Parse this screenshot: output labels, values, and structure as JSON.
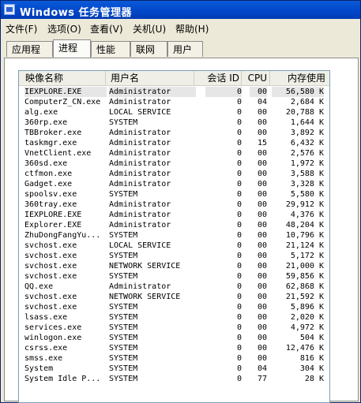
{
  "window": {
    "title": "Windows 任务管理器"
  },
  "menu": [
    "文件(F)",
    "选项(O)",
    "查看(V)",
    "关机(U)",
    "帮助(H)"
  ],
  "tabs": [
    "应用程序",
    "进程",
    "性能",
    "联网",
    "用户"
  ],
  "active_tab": "进程",
  "columns": [
    "映像名称",
    "用户名",
    "会话 ID",
    "CPU",
    "内存使用"
  ],
  "processes": [
    {
      "name": "IEXPLORE.EXE",
      "user": "Administrator",
      "session": "0",
      "cpu": "00",
      "mem": "56,580 K"
    },
    {
      "name": "ComputerZ_CN.exe",
      "user": "Administrator",
      "session": "0",
      "cpu": "04",
      "mem": "2,684 K"
    },
    {
      "name": "alg.exe",
      "user": "LOCAL SERVICE",
      "session": "0",
      "cpu": "00",
      "mem": "20,788 K"
    },
    {
      "name": "360rp.exe",
      "user": "SYSTEM",
      "session": "0",
      "cpu": "00",
      "mem": "1,644 K"
    },
    {
      "name": "TBBroker.exe",
      "user": "Administrator",
      "session": "0",
      "cpu": "00",
      "mem": "3,892 K"
    },
    {
      "name": "taskmgr.exe",
      "user": "Administrator",
      "session": "0",
      "cpu": "15",
      "mem": "6,432 K"
    },
    {
      "name": "VnetClient.exe",
      "user": "Administrator",
      "session": "0",
      "cpu": "00",
      "mem": "2,576 K"
    },
    {
      "name": "360sd.exe",
      "user": "Administrator",
      "session": "0",
      "cpu": "00",
      "mem": "1,972 K"
    },
    {
      "name": "ctfmon.exe",
      "user": "Administrator",
      "session": "0",
      "cpu": "00",
      "mem": "3,588 K"
    },
    {
      "name": "Gadget.exe",
      "user": "Administrator",
      "session": "0",
      "cpu": "00",
      "mem": "3,328 K"
    },
    {
      "name": "spoolsv.exe",
      "user": "SYSTEM",
      "session": "0",
      "cpu": "00",
      "mem": "5,580 K"
    },
    {
      "name": "360tray.exe",
      "user": "Administrator",
      "session": "0",
      "cpu": "00",
      "mem": "29,912 K"
    },
    {
      "name": "IEXPLORE.EXE",
      "user": "Administrator",
      "session": "0",
      "cpu": "00",
      "mem": "4,376 K"
    },
    {
      "name": "Explorer.EXE",
      "user": "Administrator",
      "session": "0",
      "cpu": "00",
      "mem": "48,204 K"
    },
    {
      "name": "ZhuDongFangYu...",
      "user": "SYSTEM",
      "session": "0",
      "cpu": "00",
      "mem": "10,796 K"
    },
    {
      "name": "svchost.exe",
      "user": "LOCAL SERVICE",
      "session": "0",
      "cpu": "00",
      "mem": "21,124 K"
    },
    {
      "name": "svchost.exe",
      "user": "SYSTEM",
      "session": "0",
      "cpu": "00",
      "mem": "5,172 K"
    },
    {
      "name": "svchost.exe",
      "user": "NETWORK SERVICE",
      "session": "0",
      "cpu": "00",
      "mem": "21,000 K"
    },
    {
      "name": "svchost.exe",
      "user": "SYSTEM",
      "session": "0",
      "cpu": "00",
      "mem": "59,856 K"
    },
    {
      "name": "QQ.exe",
      "user": "Administrator",
      "session": "0",
      "cpu": "00",
      "mem": "62,868 K"
    },
    {
      "name": "svchost.exe",
      "user": "NETWORK SERVICE",
      "session": "0",
      "cpu": "00",
      "mem": "21,592 K"
    },
    {
      "name": "svchost.exe",
      "user": "SYSTEM",
      "session": "0",
      "cpu": "00",
      "mem": "5,896 K"
    },
    {
      "name": "lsass.exe",
      "user": "SYSTEM",
      "session": "0",
      "cpu": "00",
      "mem": "2,020 K"
    },
    {
      "name": "services.exe",
      "user": "SYSTEM",
      "session": "0",
      "cpu": "00",
      "mem": "4,972 K"
    },
    {
      "name": "winlogon.exe",
      "user": "SYSTEM",
      "session": "0",
      "cpu": "00",
      "mem": "504 K"
    },
    {
      "name": "csrss.exe",
      "user": "SYSTEM",
      "session": "0",
      "cpu": "00",
      "mem": "12,476 K"
    },
    {
      "name": "smss.exe",
      "user": "SYSTEM",
      "session": "0",
      "cpu": "00",
      "mem": "816 K"
    },
    {
      "name": "System",
      "user": "SYSTEM",
      "session": "0",
      "cpu": "04",
      "mem": "304 K"
    },
    {
      "name": "System Idle P...",
      "user": "SYSTEM",
      "session": "0",
      "cpu": "77",
      "mem": "28 K"
    }
  ],
  "colors": {
    "titlebar": "#0046c8",
    "window_bg": "#ece9d8",
    "selection": "#e6e6e6"
  }
}
